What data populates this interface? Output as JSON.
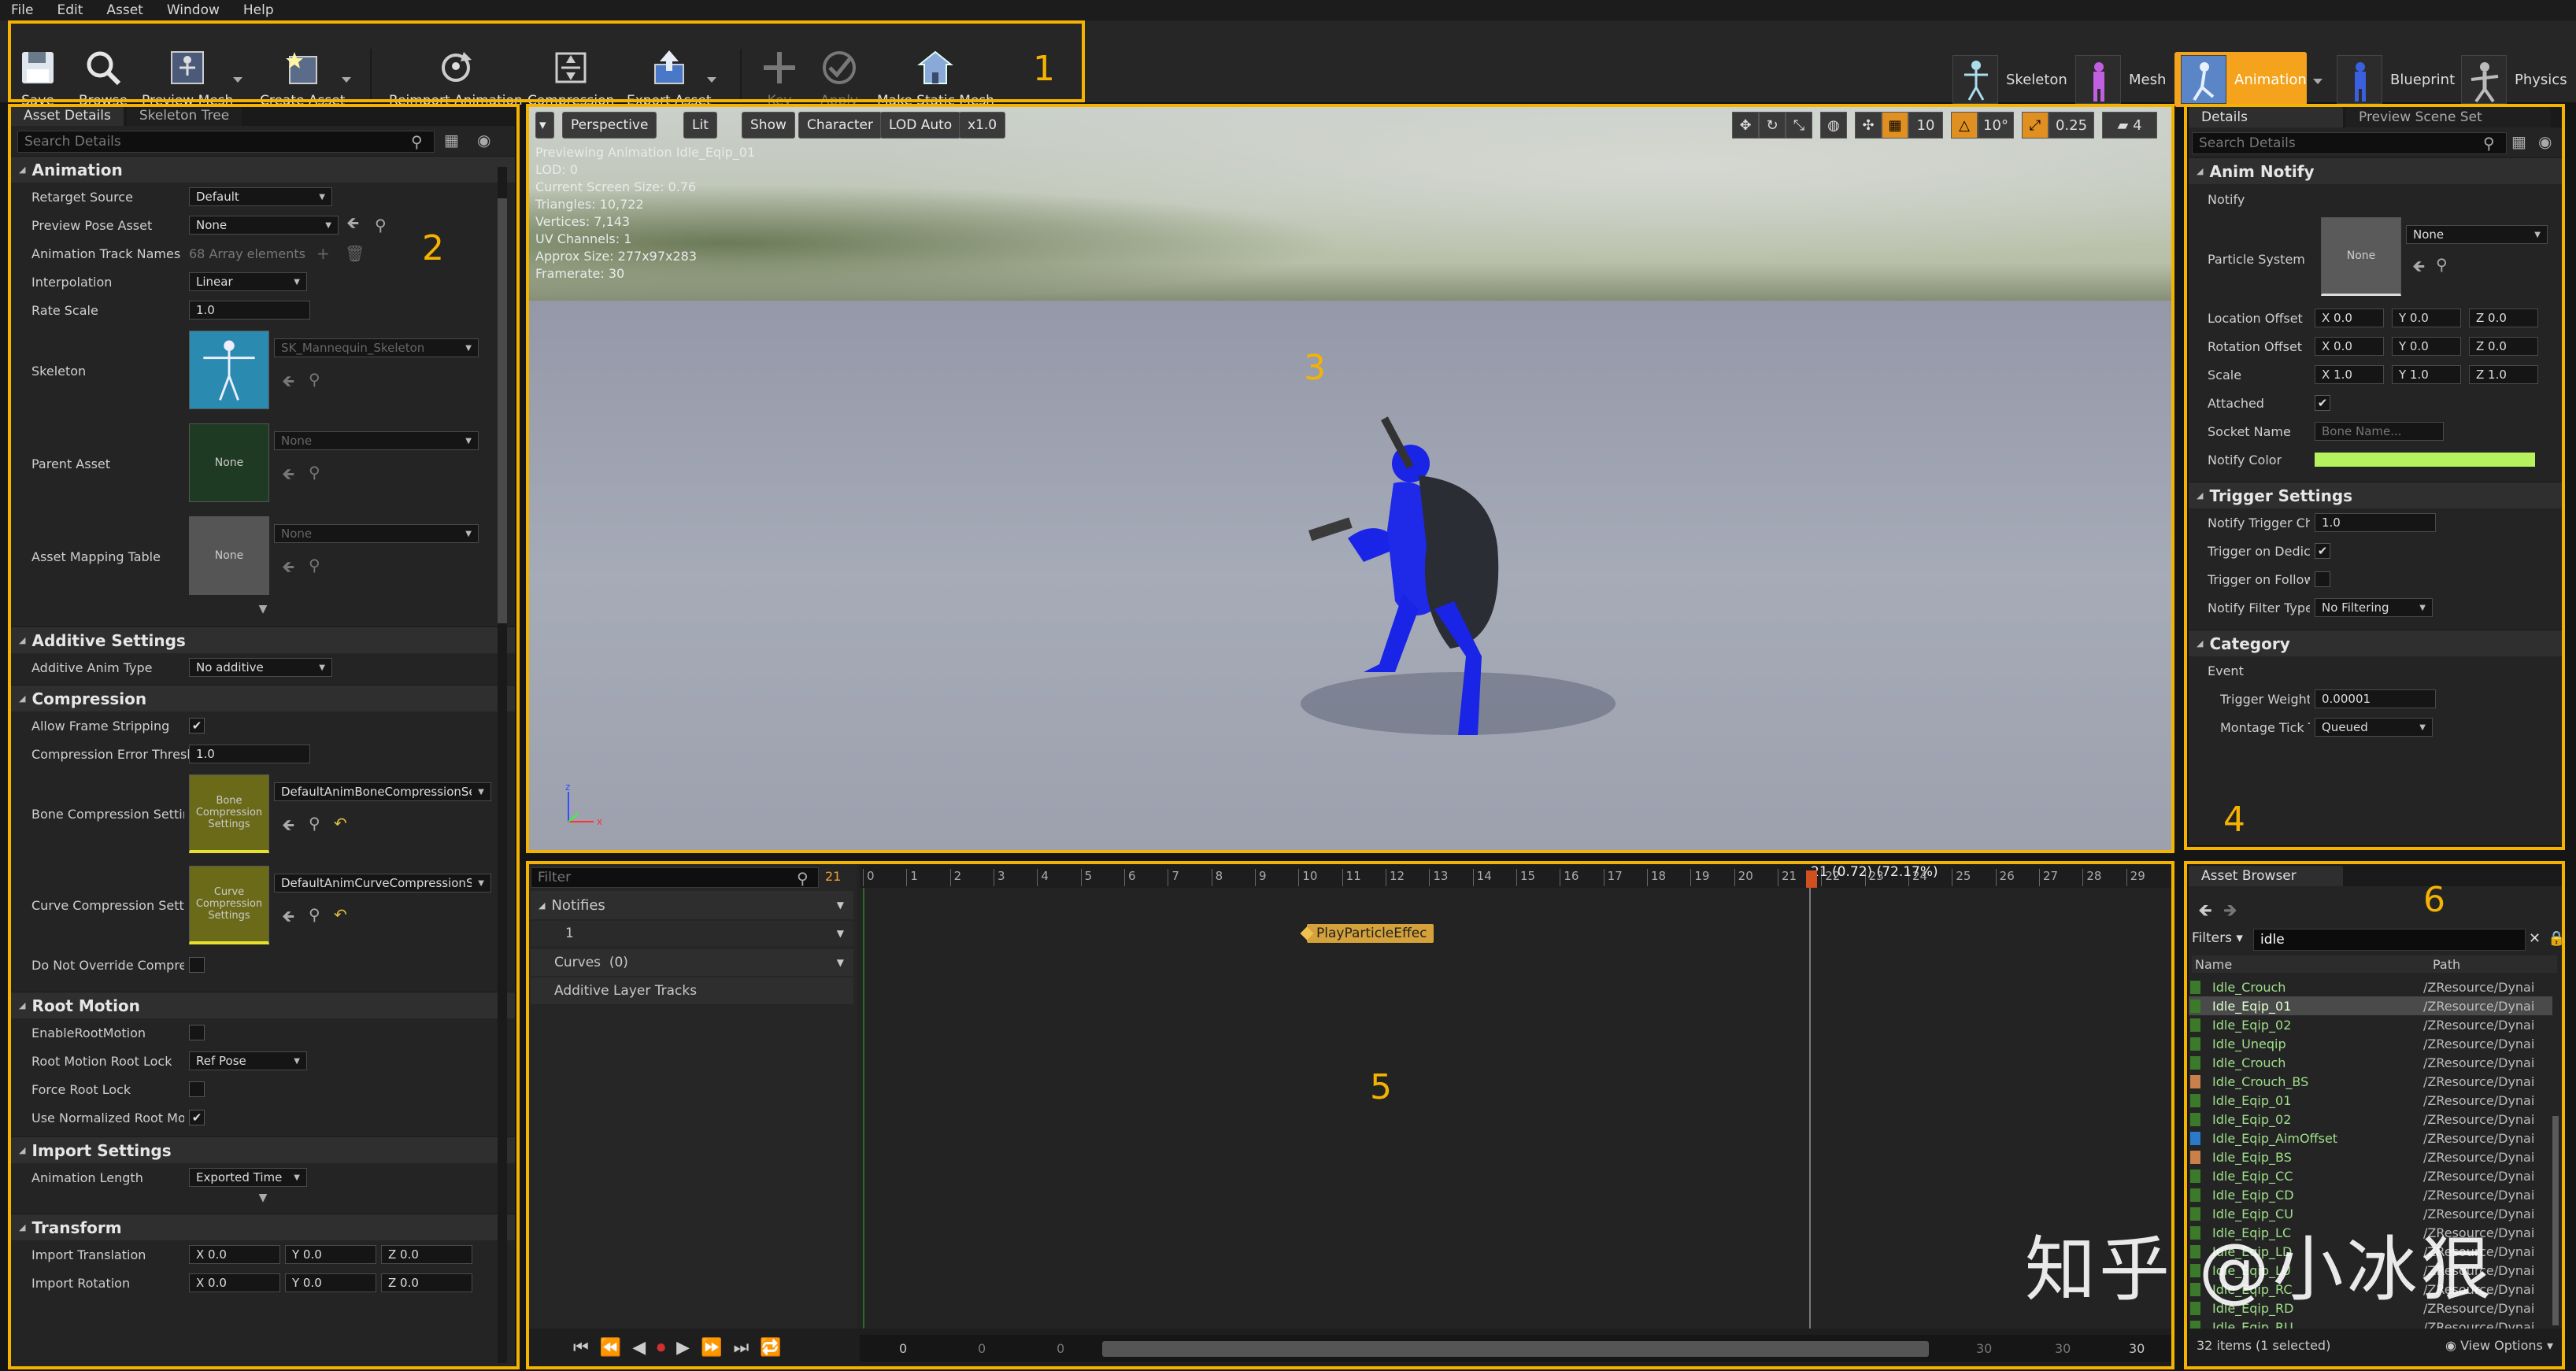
{
  "menu": [
    "File",
    "Edit",
    "Asset",
    "Window",
    "Help"
  ],
  "toolbar": {
    "save": "Save",
    "browse": "Browse",
    "preview_mesh": "Preview Mesh",
    "create_asset": "Create Asset",
    "reimport": "Reimport Animation",
    "compression": "Compression",
    "export_asset": "Export Asset",
    "key": "Key",
    "apply": "Apply",
    "make_static_mesh": "Make Static Mesh"
  },
  "modes": {
    "skeleton": "Skeleton",
    "mesh": "Mesh",
    "animation": "Animation",
    "blueprint": "Blueprint",
    "physics": "Physics"
  },
  "annotations": [
    "1",
    "2",
    "3",
    "4",
    "5",
    "6"
  ],
  "left_panel": {
    "tab_asset_details": "Asset Details",
    "tab_skeleton_tree": "Skeleton Tree",
    "search_placeholder": "Search Details",
    "animation": {
      "title": "Animation",
      "retarget_source_k": "Retarget Source",
      "retarget_source_v": "Default",
      "preview_pose_k": "Preview Pose Asset",
      "preview_pose_v": "None",
      "track_names_k": "Animation Track Names",
      "track_names_v": "68 Array elements",
      "interpolation_k": "Interpolation",
      "interpolation_v": "Linear",
      "rate_scale_k": "Rate Scale",
      "rate_scale_v": "1.0",
      "skeleton_k": "Skeleton",
      "skeleton_v": "SK_Mannequin_Skeleton",
      "parent_asset_k": "Parent Asset",
      "parent_asset_v": "None",
      "parent_thumb": "None",
      "mapping_k": "Asset Mapping Table",
      "mapping_v": "None",
      "mapping_thumb": "None"
    },
    "additive": {
      "title": "Additive Settings",
      "type_k": "Additive Anim Type",
      "type_v": "No additive"
    },
    "compression": {
      "title": "Compression",
      "allow_k": "Allow Frame Stripping",
      "error_k": "Compression Error Thresh",
      "error_v": "1.0",
      "bone_k": "Bone Compression Settin",
      "bone_v": "DefaultAnimBoneCompressionSe",
      "bone_thumb": "Bone Compression Settings",
      "curve_k": "Curve Compression Settin",
      "curve_v": "DefaultAnimCurveCompressionSe",
      "curve_thumb": "Curve Compression Settings",
      "override_k": "Do Not Override Compres"
    },
    "root_motion": {
      "title": "Root Motion",
      "enable_k": "EnableRootMotion",
      "lock_k": "Root Motion Root Lock",
      "lock_v": "Ref Pose",
      "force_k": "Force Root Lock",
      "normalized_k": "Use Normalized Root Mot"
    },
    "import": {
      "title": "Import Settings",
      "length_k": "Animation Length",
      "length_v": "Exported Time"
    },
    "transform": {
      "title": "Transform",
      "translation_k": "Import Translation",
      "rotation_k": "Import Rotation",
      "x": "X 0.0",
      "y": "Y 0.0",
      "z": "Z 0.0"
    }
  },
  "viewport": {
    "perspective": "Perspective",
    "lit": "Lit",
    "show": "Show",
    "character": "Character",
    "lod": "LOD Auto",
    "speed": "x1.0",
    "grid": "10",
    "angle": "10°",
    "scale": "0.25",
    "cam": "4",
    "stats": [
      "Previewing Animation Idle_Eqip_01",
      "LOD: 0",
      "Current Screen Size: 0.76",
      "Triangles: 10,722",
      "Vertices: 7,143",
      "UV Channels: 1",
      "Approx Size: 277x97x283",
      "Framerate: 30"
    ]
  },
  "right_panel": {
    "tab_details": "Details",
    "tab_preview": "Preview Scene Set",
    "search_placeholder": "Search Details",
    "anim_notify": {
      "title": "Anim Notify",
      "notify_k": "Notify",
      "particle_k": "Particle System",
      "particle_v": "None",
      "particle_thumb": "None",
      "loc_k": "Location Offset",
      "rot_k": "Rotation Offset",
      "scale_k": "Scale",
      "x0": "X 0.0",
      "y0": "Y 0.0",
      "z0": "Z 0.0",
      "x1": "X 1.0",
      "y1": "Y 1.0",
      "z1": "Z 1.0",
      "attached_k": "Attached",
      "socket_k": "Socket Name",
      "socket_v": "Bone Name...",
      "color_k": "Notify Color",
      "notify_color": "#b6f25e"
    },
    "trigger": {
      "title": "Trigger Settings",
      "chance_k": "Notify Trigger Chan",
      "chance_v": "1.0",
      "dedicated_k": "Trigger on Dedicat",
      "follower_k": "Trigger on Follower",
      "filter_k": "Notify Filter Type",
      "filter_v": "No Filtering"
    },
    "category": {
      "title": "Category",
      "event": "Event",
      "weight_k": "Trigger Weight Th",
      "weight_v": "0.00001",
      "montage_k": "Montage Tick Typ",
      "montage_v": "Queued"
    }
  },
  "timeline": {
    "filter_placeholder": "Filter",
    "frame_badge": "21",
    "notifies": "Notifies",
    "notify_track": "1",
    "curves": "Curves",
    "curves_count": "(0)",
    "additive": "Additive Layer Tracks",
    "playhead": "21 (0.72) (72.17%)",
    "notify_event": "PlayParticleEffec",
    "ticks": [
      "0",
      "1",
      "2",
      "3",
      "4",
      "5",
      "6",
      "7",
      "8",
      "9",
      "10",
      "11",
      "12",
      "13",
      "14",
      "15",
      "16",
      "17",
      "18",
      "19",
      "20",
      "21",
      "22",
      "23",
      "24",
      "25",
      "26",
      "27",
      "28",
      "29"
    ],
    "range_left": [
      "0",
      "0",
      "0"
    ],
    "range_right": [
      "30",
      "30",
      "30"
    ]
  },
  "asset_browser": {
    "tab": "Asset Browser",
    "filters": "Filters",
    "search": "idle",
    "col_name": "Name",
    "col_path": "Path",
    "items": [
      {
        "name": "Idle_Crouch",
        "path": "/ZResource/Dynai",
        "color": "#3a7a2a"
      },
      {
        "name": "Idle_Eqip_01",
        "path": "/ZResource/Dynai",
        "color": "#3a7a2a"
      },
      {
        "name": "Idle_Eqip_02",
        "path": "/ZResource/Dynai",
        "color": "#3a7a2a"
      },
      {
        "name": "Idle_Uneqip",
        "path": "/ZResource/Dynai",
        "color": "#3a7a2a"
      },
      {
        "name": "Idle_Crouch",
        "path": "/ZResource/Dynai",
        "color": "#3a7a2a"
      },
      {
        "name": "Idle_Crouch_BS",
        "path": "/ZResource/Dynai",
        "color": "#c9804a"
      },
      {
        "name": "Idle_Eqip_01",
        "path": "/ZResource/Dynai",
        "color": "#3a7a2a"
      },
      {
        "name": "Idle_Eqip_02",
        "path": "/ZResource/Dynai",
        "color": "#3a7a2a"
      },
      {
        "name": "Idle_Eqip_AimOffset",
        "path": "/ZResource/Dynai",
        "color": "#2a7ac9"
      },
      {
        "name": "Idle_Eqip_BS",
        "path": "/ZResource/Dynai",
        "color": "#c9804a"
      },
      {
        "name": "Idle_Eqip_CC",
        "path": "/ZResource/Dynai",
        "color": "#3a7a2a"
      },
      {
        "name": "Idle_Eqip_CD",
        "path": "/ZResource/Dynai",
        "color": "#3a7a2a"
      },
      {
        "name": "Idle_Eqip_CU",
        "path": "/ZResource/Dynai",
        "color": "#3a7a2a"
      },
      {
        "name": "Idle_Eqip_LC",
        "path": "/ZResource/Dynai",
        "color": "#3a7a2a"
      },
      {
        "name": "Idle_Eqip_LD",
        "path": "/ZResource/Dynai",
        "color": "#3a7a2a"
      },
      {
        "name": "Idle_Eqip_LU",
        "path": "/ZResource/Dynai",
        "color": "#3a7a2a"
      },
      {
        "name": "Idle_Eqip_RC",
        "path": "/ZResource/Dynai",
        "color": "#3a7a2a"
      },
      {
        "name": "Idle_Eqip_RD",
        "path": "/ZResource/Dynai",
        "color": "#3a7a2a"
      },
      {
        "name": "Idle_Eqip_RU",
        "path": "/ZResource/Dynai",
        "color": "#3a7a2a"
      }
    ],
    "count": "32 items (1 selected)",
    "view_options": "View Options"
  },
  "watermark": "知乎 @小冰狠",
  "colors": {
    "highlight": "#f5b301",
    "character": "#1a24e6",
    "shield": "#2a2d33"
  }
}
